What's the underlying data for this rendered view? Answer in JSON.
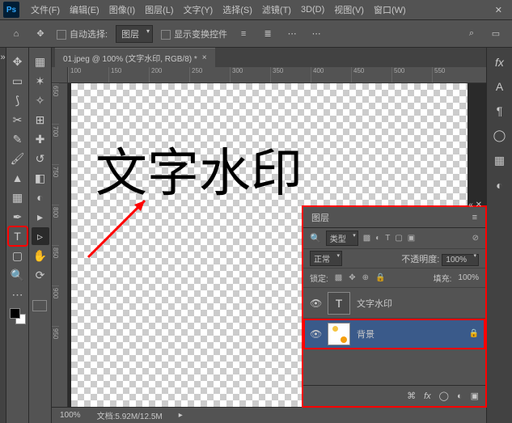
{
  "menubar": {
    "items": [
      "文件(F)",
      "编辑(E)",
      "图像(I)",
      "图层(L)",
      "文字(Y)",
      "选择(S)",
      "滤镜(T)",
      "3D(D)",
      "视图(V)",
      "窗口(W)"
    ]
  },
  "optbar": {
    "auto_select": "自动选择:",
    "target": "图层",
    "show_transform": "显示变换控件"
  },
  "doc": {
    "tab": "01.jpeg @ 100% (文字水印, RGB/8) *",
    "canvas_text": "文字水印",
    "ruler_h": [
      "100",
      "150",
      "200",
      "250",
      "300",
      "350",
      "400",
      "450",
      "500",
      "550"
    ],
    "ruler_v": [
      "650",
      "700",
      "750",
      "800",
      "850",
      "900",
      "950"
    ]
  },
  "status": {
    "zoom": "100%",
    "info": "文档:5.92M/12.5M"
  },
  "layers": {
    "panel_title": "图层",
    "filter_mode": "类型",
    "blend_mode": "正常",
    "opacity_label": "不透明度:",
    "opacity_value": "100%",
    "lock_label": "锁定:",
    "fill_label": "填充:",
    "fill_value": "100%",
    "list": [
      {
        "kind": "text",
        "name": "文字水印",
        "thumb_glyph": "T",
        "visible": true
      },
      {
        "kind": "image",
        "name": "背景",
        "locked": true,
        "visible": true,
        "selected": true
      }
    ]
  }
}
